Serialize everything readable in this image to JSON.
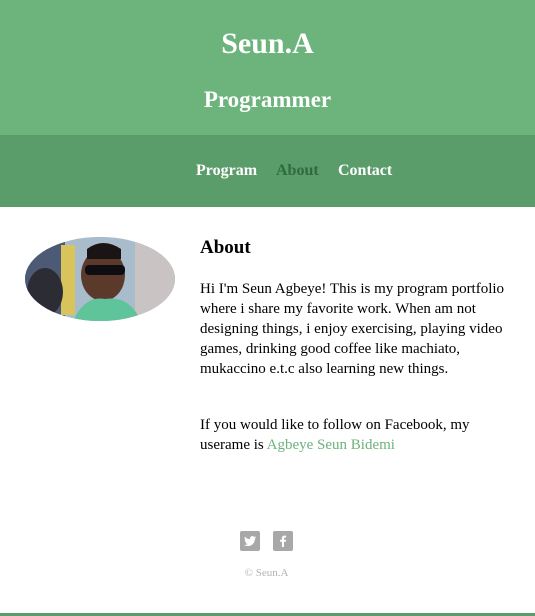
{
  "header": {
    "site_name": "Seun.A",
    "role": "Programmer"
  },
  "nav": {
    "items": [
      {
        "label": "Program",
        "active": false
      },
      {
        "label": "About",
        "active": true
      },
      {
        "label": "Contact",
        "active": false
      }
    ]
  },
  "about": {
    "title": "About",
    "paragraph1": "Hi I'm Seun Agbeye! This is my program portfolio where i share my favorite work. When am not designing things, i enjoy exercising, playing video games, drinking good coffee like machiato, mukaccino e.t.c also learning new things.",
    "paragraph2_prefix": "If you would like to follow on Facebook, my userame is ",
    "facebook_link_text": "Agbeye Seun Bidemi"
  },
  "footer": {
    "social_icons": [
      "twitter-icon",
      "facebook-icon"
    ],
    "copyright": "© Seun.A"
  },
  "colors": {
    "header_bg": "#6cb37c",
    "nav_bg": "#5b9c6b",
    "nav_active": "#2f6a3e",
    "link": "#6cb37c",
    "icon_gray": "#a8a8a8"
  }
}
